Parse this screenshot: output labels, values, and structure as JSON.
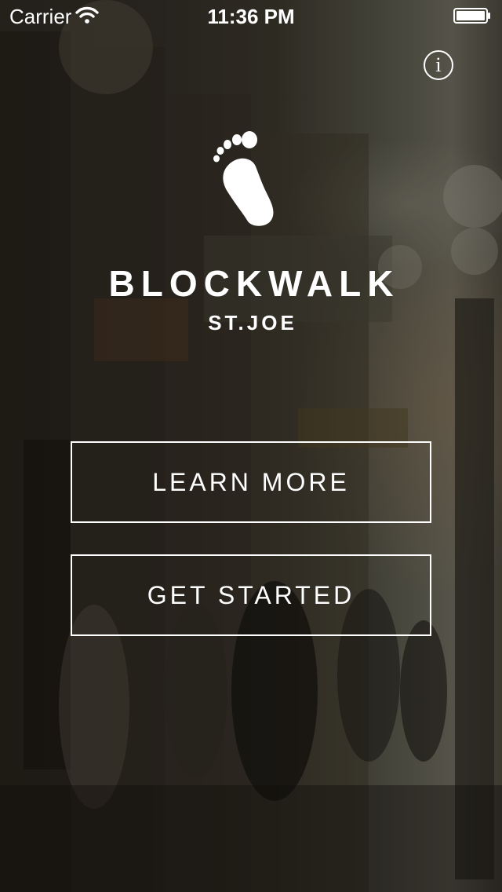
{
  "status_bar": {
    "carrier": "Carrier",
    "time": "11:36 PM",
    "wifi_icon": "wifi-icon",
    "battery_icon": "battery-icon"
  },
  "header": {
    "info_icon_label": "i"
  },
  "branding": {
    "logo_icon": "footprint-icon",
    "title": "BLOCKWALK",
    "subtitle": "ST.JOE"
  },
  "actions": {
    "learn_more_label": "LEARN MORE",
    "get_started_label": "GET STARTED"
  },
  "colors": {
    "text": "#ffffff",
    "button_border": "#ffffff"
  }
}
